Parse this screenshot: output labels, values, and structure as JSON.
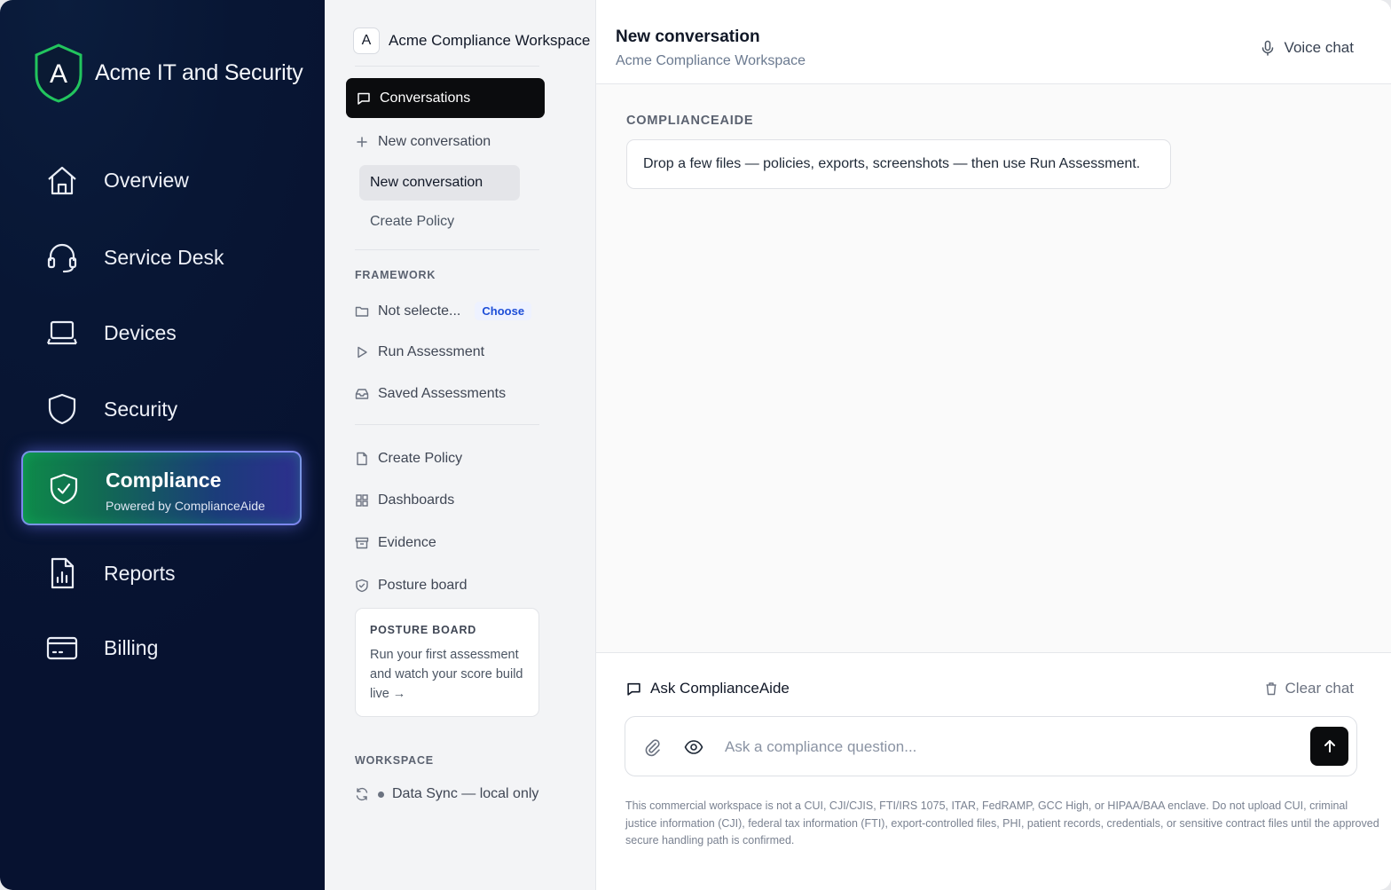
{
  "brand": {
    "logo_letter": "A",
    "title": "Acme IT and Security"
  },
  "nav": {
    "items": [
      {
        "label": "Overview",
        "icon": "home-icon"
      },
      {
        "label": "Service Desk",
        "icon": "headset-icon"
      },
      {
        "label": "Devices",
        "icon": "laptop-icon"
      },
      {
        "label": "Security",
        "icon": "shield-icon"
      },
      {
        "label": "Compliance",
        "sublabel": "Powered by ComplianceAide",
        "icon": "shield-check-icon",
        "active": true
      },
      {
        "label": "Reports",
        "icon": "report-icon"
      },
      {
        "label": "Billing",
        "icon": "credit-card-icon"
      }
    ]
  },
  "workspace": {
    "avatar_letter": "A",
    "name": "Acme Compliance Workspace",
    "conversations_label": "Conversations",
    "new_conversation_label": "New conversation",
    "conversation_items": [
      "New conversation",
      "Create Policy"
    ],
    "framework_section": "FRAMEWORK",
    "framework_value": "Not selecte...",
    "choose_label": "Choose",
    "run_assessment": "Run Assessment",
    "saved_assessments": "Saved Assessments",
    "create_policy": "Create Policy",
    "dashboards": "Dashboards",
    "evidence": "Evidence",
    "posture_board": "Posture board",
    "posture_card": {
      "title": "POSTURE BOARD",
      "body": "Run your first assessment and watch your score build live →"
    },
    "workspace_section": "WORKSPACE",
    "data_sync": "Data Sync — local only"
  },
  "chat": {
    "title": "New conversation",
    "subtitle": "Acme Compliance Workspace",
    "voice_chat": "Voice chat",
    "assistant_name": "COMPLIANCEAIDE",
    "assistant_message": "Drop a few files — policies, exports, screenshots — then use Run Assessment.",
    "ask_label": "Ask ComplianceAide",
    "clear_label": "Clear chat",
    "input_placeholder": "Ask a compliance question...",
    "input_value": "",
    "disclaimer": "This commercial workspace is not a CUI, CJI/CJIS, FTI/IRS 1075, ITAR, FedRAMP, GCC High, or HIPAA/BAA enclave. Do not upload CUI, criminal justice information (CJI), federal tax information (FTI), export-controlled files, PHI, patient records, credentials, or sensitive contract files until the approved secure handling path is confirmed."
  },
  "colors": {
    "nav_bg": "#071230",
    "active_green": "#0e8a4a",
    "active_violet": "#2d2f8e",
    "choose_blue": "#1d4ed8",
    "primary_button": "#0b0c0e"
  }
}
